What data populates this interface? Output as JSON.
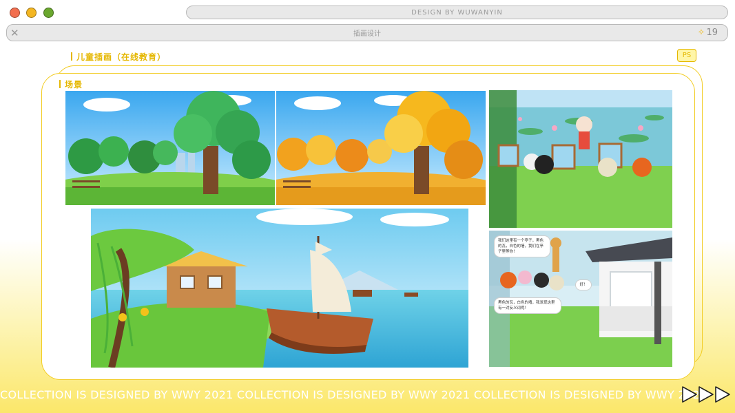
{
  "window": {
    "controls": [
      {
        "name": "close",
        "color": "#f26f4f"
      },
      {
        "name": "minimize",
        "color": "#f3b622"
      },
      {
        "name": "maximize",
        "color": "#6aa72e"
      }
    ],
    "top_title": "DESIGN BY WUWANYIN"
  },
  "address_bar": {
    "title": "插画设计",
    "page_number": "19"
  },
  "section": {
    "title": "儿童插画（在线教育）",
    "badge": "PS",
    "subsection": "场景"
  },
  "illustrations": [
    {
      "name": "summer-forest",
      "season": "green"
    },
    {
      "name": "autumn-forest",
      "season": "autumn"
    },
    {
      "name": "lake-painting"
    },
    {
      "name": "river-boat"
    },
    {
      "name": "pavilion-dialogue"
    }
  ],
  "dialogue": {
    "bubble_1": "我们这里有一个亭子，黑色的瓦，白色的墙，我们在亭子里等你！",
    "bubble_2": "好！",
    "bubble_3": "黑色的瓦，白色的墙，我发现这里有一对反义词呢！"
  },
  "footer": {
    "marquee": "COLLECTION IS DESIGNED BY WWY  2021  COLLECTION IS DESIGNED BY WWY  2021  COLLECTION IS DESIGNED BY WWY  2021",
    "arrow_count": 3
  },
  "colors": {
    "accent": "#e5b700",
    "frame": "#f2cc22",
    "background_bottom": "#fbe76a"
  }
}
